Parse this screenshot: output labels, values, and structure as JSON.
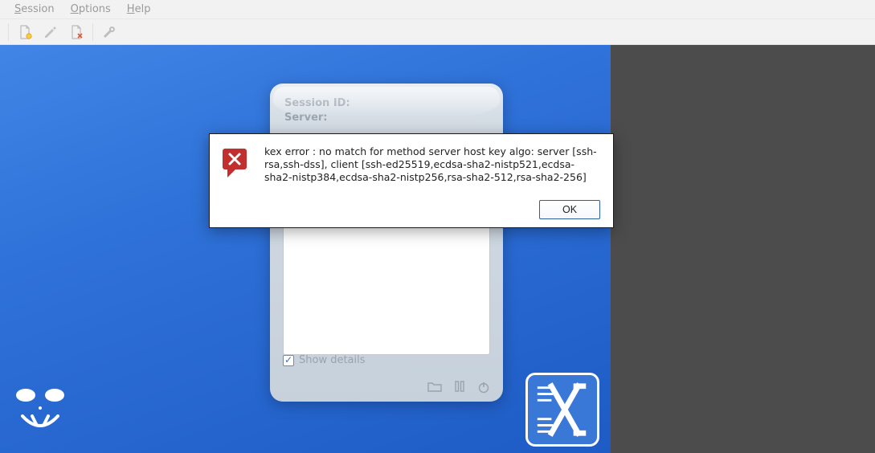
{
  "menubar": {
    "session": "Session",
    "options": "Options",
    "help": "Help"
  },
  "toolbar": {
    "new_session": "new-session-icon",
    "edit": "edit-icon",
    "delete_session": "delete-session-icon",
    "settings": "settings-icon"
  },
  "card": {
    "session_id_label": "Session ID:",
    "server_label": "Server:",
    "show_details_label": "Show details",
    "show_details_checked": true
  },
  "dialog": {
    "message": "kex error : no match for method server host key algo: server [ssh-rsa,ssh-dss], client [ssh-ed25519,ecdsa-sha2-nistp521,ecdsa-sha2-nistp384,ecdsa-sha2-nistp256,rsa-sha2-512,rsa-sha2-256]",
    "ok_label": "OK"
  }
}
